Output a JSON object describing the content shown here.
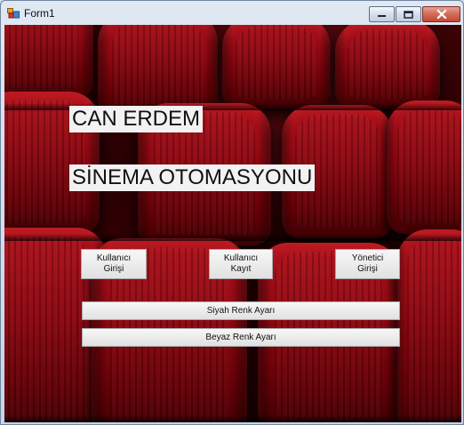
{
  "window": {
    "title": "Form1"
  },
  "icons": {
    "app": "app-icon",
    "minimize": "minimize-icon",
    "maximize": "maximize-icon",
    "close": "close-icon"
  },
  "colors": {
    "seat_red": "#a10f18",
    "dark_red": "#2a0004",
    "label_background": "#f2f2f2",
    "button_background": "#e6e6e6",
    "close_red": "#c44834"
  },
  "main": {
    "title_line_1": "CAN ERDEM",
    "title_line_2": "SİNEMA OTOMASYONU",
    "buttons": {
      "user_login": "Kullanıcı\nGirişi",
      "user_register": "Kullanıcı\nKayıt",
      "admin_login": "Yönetici\nGirişi",
      "black_theme": "Siyah Renk Ayarı",
      "white_theme": "Beyaz Renk Ayarı"
    }
  }
}
